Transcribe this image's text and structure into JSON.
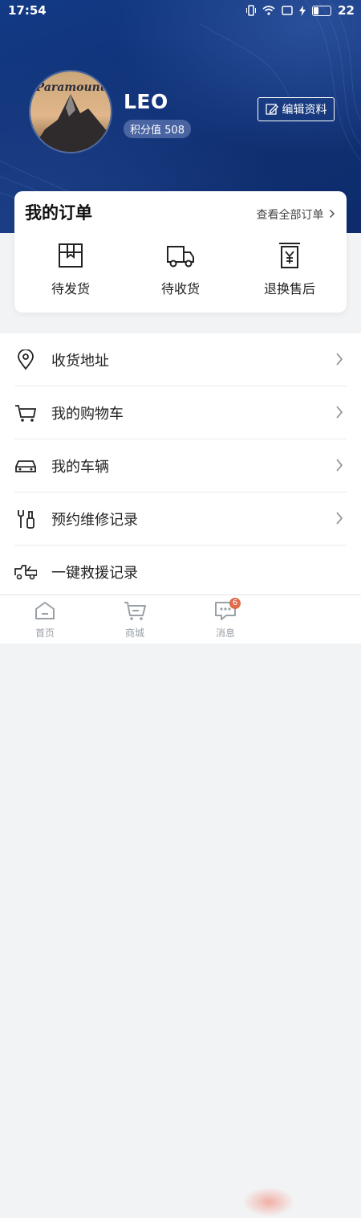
{
  "status_bar": {
    "time": "17:54",
    "battery": "22"
  },
  "profile": {
    "username": "LEO",
    "points_label": "积分值",
    "points_value": "508",
    "edit_label": "编辑资料",
    "avatar_logo_text": "Paramount"
  },
  "orders": {
    "title": "我的订单",
    "view_all": "查看全部订单",
    "items": [
      {
        "label": "待发货",
        "icon": "package-icon"
      },
      {
        "label": "待收货",
        "icon": "truck-icon"
      },
      {
        "label": "退换售后",
        "icon": "refund-icon"
      }
    ]
  },
  "menu": {
    "items": [
      {
        "label": "收货地址",
        "icon": "location-pin-icon"
      },
      {
        "label": "我的购物车",
        "icon": "cart-icon"
      },
      {
        "label": "我的车辆",
        "icon": "car-icon"
      },
      {
        "label": "预约维修记录",
        "icon": "repair-tools-icon"
      },
      {
        "label": "一键救援记录",
        "icon": "tow-truck-icon"
      }
    ]
  },
  "tabbar": {
    "items": [
      {
        "label": "首页",
        "icon": "home-icon"
      },
      {
        "label": "商城",
        "icon": "shop-cart-icon"
      },
      {
        "label": "消息",
        "icon": "message-icon",
        "badge": "6"
      }
    ]
  },
  "colors": {
    "header_bg": "#0f2f72",
    "inactive_tab": "#9aa0a8",
    "badge": "#e06a4a"
  }
}
